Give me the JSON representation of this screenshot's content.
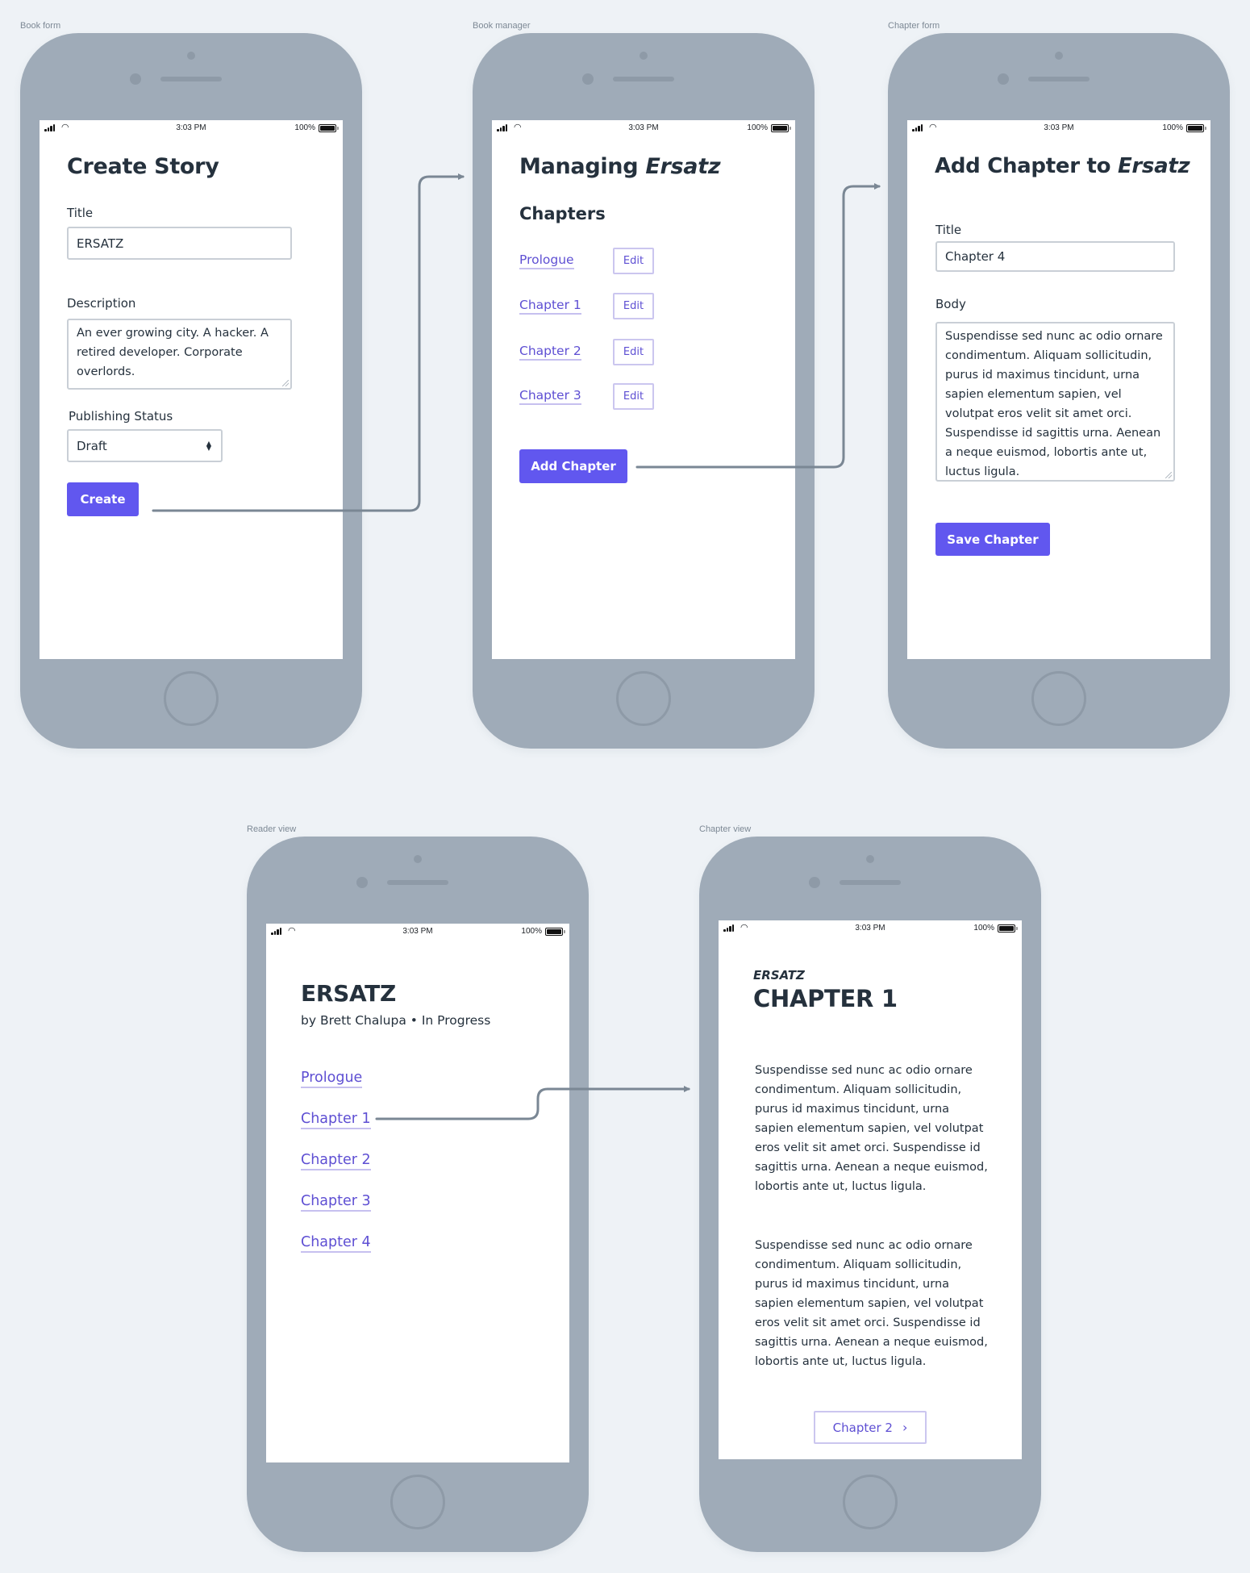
{
  "status_bar": {
    "time": "3:03 PM",
    "battery": "100%",
    "signal_icon": "signal-bars-icon",
    "wifi_icon": "wifi-icon",
    "battery_icon": "battery-icon"
  },
  "colors": {
    "background": "#eef2f6",
    "phone": "#9fabb8",
    "accent": "#6157ef",
    "link": "#5e4fd3",
    "text": "#25313d",
    "connector": "#7a8794"
  },
  "frames": [
    {
      "id": "book-form",
      "label": "Book form"
    },
    {
      "id": "book-manager",
      "label": "Book manager"
    },
    {
      "id": "chapter-form",
      "label": "Chapter form"
    },
    {
      "id": "reader-view",
      "label": "Reader view"
    },
    {
      "id": "chapter-view",
      "label": "Chapter view"
    }
  ],
  "book_form": {
    "title": "Create Story",
    "title_label": "Title",
    "title_value": "ERSATZ",
    "description_label": "Description",
    "description_value": "An ever growing city. A hacker. A retired developer. Corporate overlords.",
    "status_label": "Publishing Status",
    "status_value": "Draft",
    "submit_label": "Create"
  },
  "book_manager": {
    "title_prefix": "Managing ",
    "title_book": "Ersatz",
    "section_title": "Chapters",
    "chapters": [
      {
        "title": "Prologue",
        "edit_label": "Edit"
      },
      {
        "title": "Chapter 1",
        "edit_label": "Edit"
      },
      {
        "title": "Chapter 2",
        "edit_label": "Edit"
      },
      {
        "title": "Chapter 3",
        "edit_label": "Edit"
      }
    ],
    "add_label": "Add Chapter"
  },
  "chapter_form": {
    "title_prefix": "Add Chapter to ",
    "title_book": "Ersatz",
    "title_label": "Title",
    "title_value": "Chapter 4",
    "body_label": "Body",
    "body_value": "Suspendisse sed nunc ac odio ornare condimentum. Aliquam sollicitudin, purus id maximus tincidunt, urna sapien elementum sapien, vel volutpat eros velit sit amet orci. Suspendisse id sagittis urna. Aenean a neque euismod, lobortis ante ut, luctus ligula.",
    "submit_label": "Save Chapter"
  },
  "reader_view": {
    "book_title": "ERSATZ",
    "byline": "by Brett Chalupa • In Progress",
    "chapters": [
      "Prologue",
      "Chapter 1",
      "Chapter 2",
      "Chapter 3",
      "Chapter 4"
    ]
  },
  "chapter_view": {
    "book_title": "ERSATZ",
    "chapter_title": "CHAPTER 1",
    "paragraphs": [
      "Suspendisse sed nunc ac odio ornare condimentum. Aliquam sollicitudin, purus id maximus tincidunt, urna sapien elementum sapien, vel volutpat eros velit sit amet orci. Suspendisse id sagittis urna. Aenean a neque euismod, lobortis ante ut, luctus ligula.",
      "Suspendisse sed nunc ac odio ornare condimentum. Aliquam sollicitudin, purus id maximus tincidunt, urna sapien elementum sapien, vel volutpat eros velit sit amet orci. Suspendisse id sagittis urna. Aenean a neque euismod, lobortis ante ut, luctus ligula."
    ],
    "next_label": "Chapter 2",
    "next_icon": "chevron-right-icon"
  },
  "flows": [
    {
      "from": "book-form.create-button",
      "to": "book-manager"
    },
    {
      "from": "book-manager.add-chapter-button",
      "to": "chapter-form"
    },
    {
      "from": "reader-view.chapter-1-link",
      "to": "chapter-view"
    }
  ]
}
